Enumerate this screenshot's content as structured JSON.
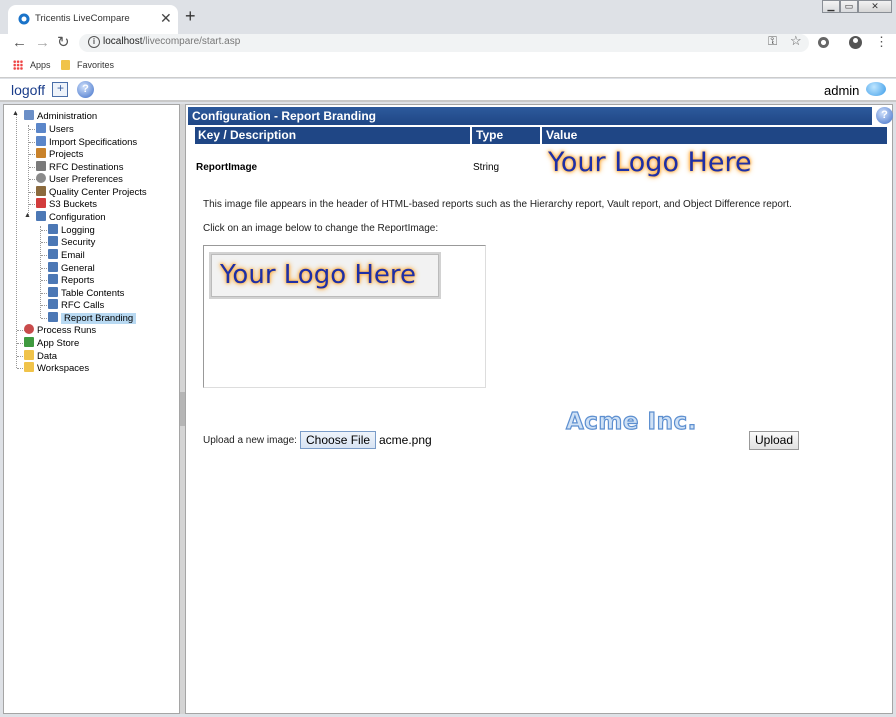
{
  "browser": {
    "tab_title": "Tricentis LiveCompare",
    "tab_close": "✕",
    "new_tab": "+",
    "url_host": "localhost",
    "url_path": "/livecompare/start.asp",
    "bookmarks": [
      {
        "label": "Apps",
        "icon": "apps-grid-icon"
      },
      {
        "label": "Favorites",
        "icon": "folder-icon"
      }
    ]
  },
  "appbar": {
    "logoff": "logoff",
    "user": "admin"
  },
  "tree": {
    "items": [
      {
        "label": "Administration",
        "icon": "admin-icon",
        "color": "#6b8fc7"
      },
      {
        "label": "Users",
        "icon": "users-icon",
        "color": "#5b86c9"
      },
      {
        "label": "Import Specifications",
        "icon": "import-icon",
        "color": "#5b86c9"
      },
      {
        "label": "Projects",
        "icon": "projects-icon",
        "color": "#c9822a"
      },
      {
        "label": "RFC Destinations",
        "icon": "rfc-icon",
        "color": "#7a7a7a"
      },
      {
        "label": "User Preferences",
        "icon": "preferences-icon",
        "color": "#8a8a8a"
      },
      {
        "label": "Quality Center Projects",
        "icon": "qc-icon",
        "color": "#8b6a3d"
      },
      {
        "label": "S3 Buckets",
        "icon": "bucket-icon",
        "color": "#d23c3c"
      },
      {
        "label": "Configuration",
        "icon": "config-icon",
        "color": "#4c78b5"
      },
      {
        "label": "Logging",
        "icon": "config-icon",
        "color": "#4c78b5"
      },
      {
        "label": "Security",
        "icon": "config-icon",
        "color": "#4c78b5"
      },
      {
        "label": "Email",
        "icon": "config-icon",
        "color": "#4c78b5"
      },
      {
        "label": "General",
        "icon": "config-icon",
        "color": "#4c78b5"
      },
      {
        "label": "Reports",
        "icon": "config-icon",
        "color": "#4c78b5"
      },
      {
        "label": "Table Contents",
        "icon": "config-icon",
        "color": "#4c78b5"
      },
      {
        "label": "RFC Calls",
        "icon": "config-icon",
        "color": "#4c78b5"
      },
      {
        "label": "Report Branding",
        "icon": "config-icon",
        "color": "#4c78b5"
      },
      {
        "label": "Process Runs",
        "icon": "process-runs-icon",
        "color": "#c94b4b"
      },
      {
        "label": "App Store",
        "icon": "app-store-icon",
        "color": "#3f9a3f"
      },
      {
        "label": "Data",
        "icon": "folder-icon",
        "color": "#f0c34a"
      },
      {
        "label": "Workspaces",
        "icon": "folder-icon",
        "color": "#f0c34a"
      }
    ],
    "selected": "Report Branding"
  },
  "content": {
    "header": "Configuration - Report Branding",
    "columns": [
      "Key / Description",
      "Type",
      "Value"
    ],
    "row": {
      "key": "ReportImage",
      "type": "String"
    },
    "logo_text": "Your Logo Here",
    "description": "This image file appears in the header of HTML-based reports such as the Hierarchy report, Vault report, and Object Difference report.",
    "click_hint": "Click on an image below to change the ReportImage:",
    "thumb_logo_text": "Your Logo Here",
    "acme_text": "Acme Inc.",
    "upload_label": "Upload a new image:",
    "choose_file": "Choose File",
    "filename": "acme.png",
    "upload_button": "Upload"
  },
  "colors": {
    "header_blue": "#1f4685",
    "logo_blue": "#1e2fa6",
    "logo_glow": "#ff9a1f",
    "selected_bg": "#b8d9f2"
  }
}
